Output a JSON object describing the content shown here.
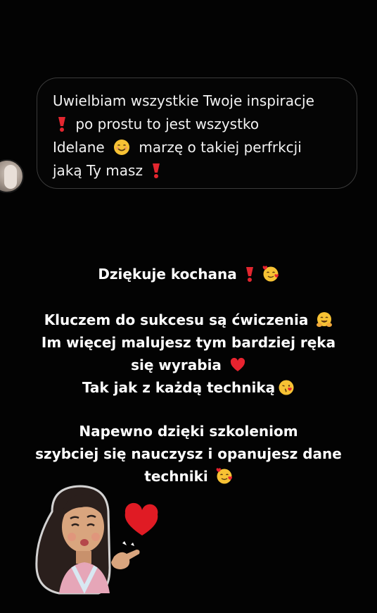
{
  "message": {
    "line1": "Uwielbiam wszystkie Twoje inspiracje",
    "line2": "po prostu to jest wszystko",
    "line3a": "Idelane",
    "line3b": "marzę o takiej perfrkcji",
    "line4": "jaką Ty masz"
  },
  "reply": {
    "thanks": "Dziękuje kochana",
    "p1": "Kluczem do sukcesu są ćwiczenia",
    "p2": "Im więcej malujesz tym bardziej ręka",
    "p3": "się wyrabia",
    "p4": "Tak jak z każdą techniką",
    "p5": "Napewno dzięki szkoleniom",
    "p6": "szybciej się nauczysz i opanujesz dane",
    "p7": "techniki"
  },
  "icons": {
    "exclamation": "red-heavy-exclamation-icon",
    "smile": "smiling-face-icon",
    "hearts_face": "smiling-face-with-hearts-icon",
    "hug": "hugging-face-icon",
    "heart": "red-heart-icon",
    "kiss": "face-blowing-kiss-icon",
    "sticker": "memoji-girl-heart-sticker"
  },
  "colors": {
    "background": "#030303",
    "bubble_border": "#3a3a3a",
    "text": "#ffffff",
    "heart": "#e8232f",
    "emoji_yellow": "#f7c234"
  }
}
